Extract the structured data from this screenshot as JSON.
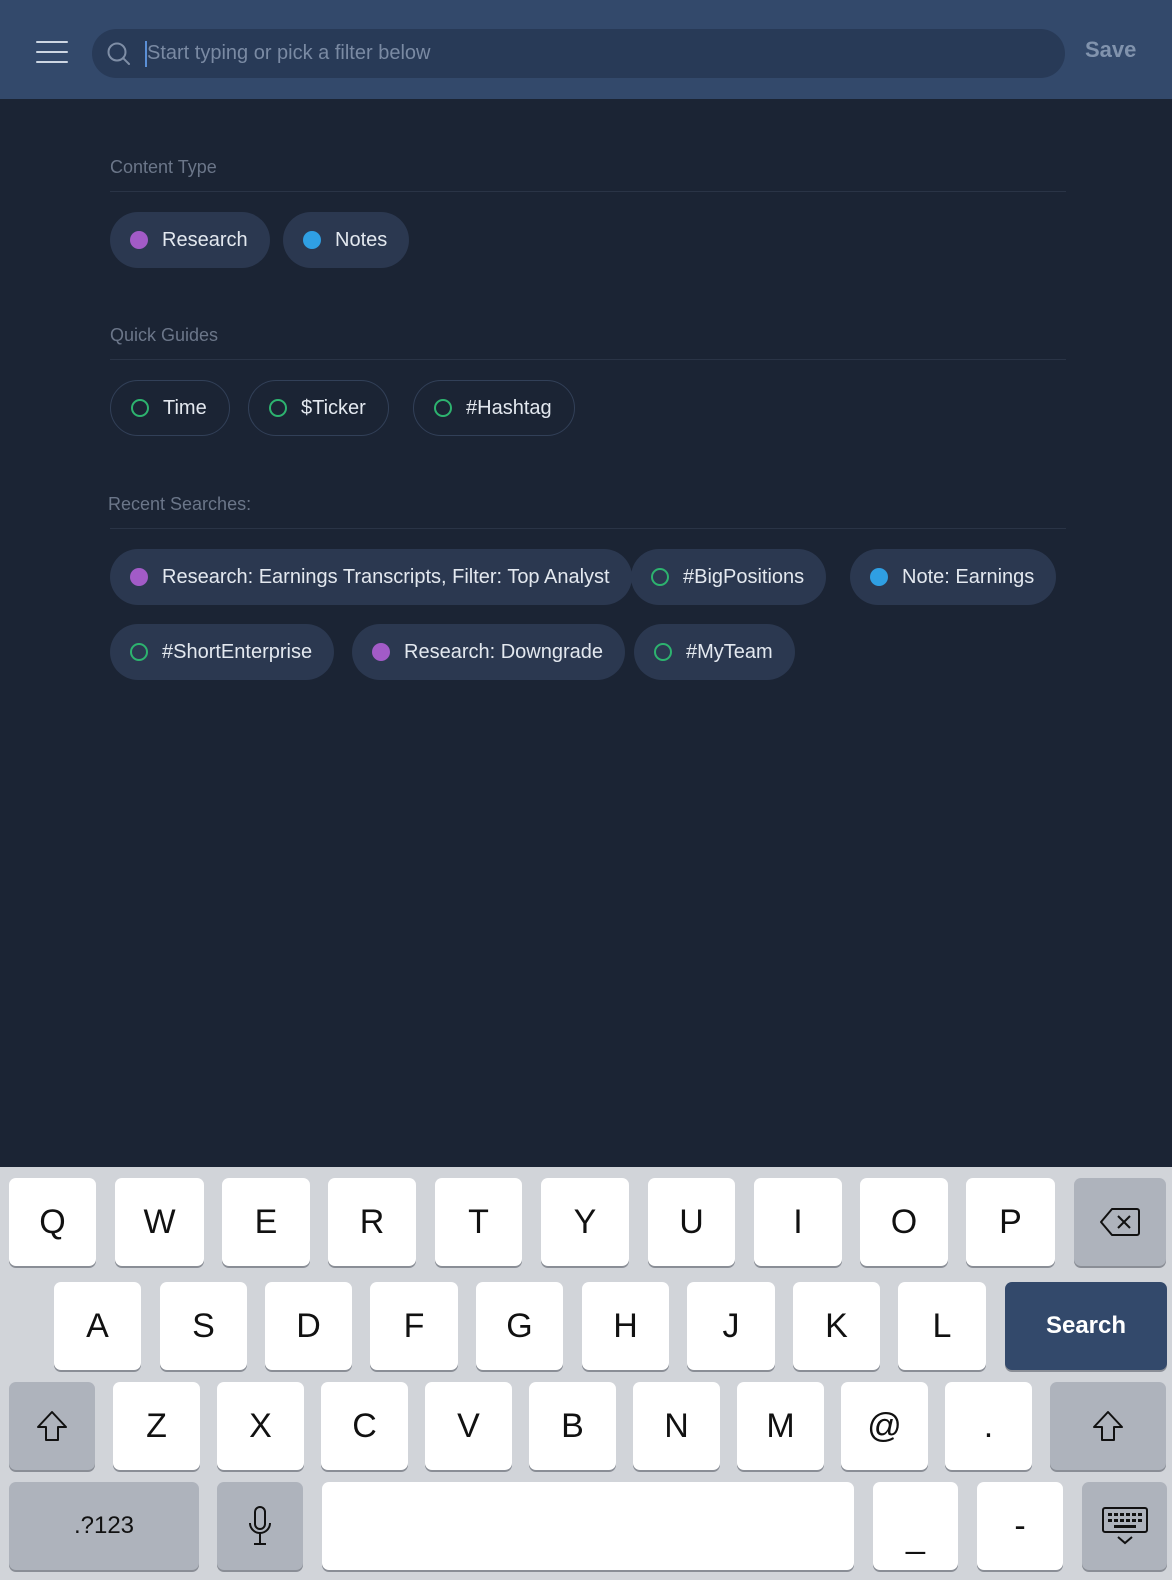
{
  "header": {
    "search_placeholder": "Start typing or pick a filter below",
    "save_label": "Save"
  },
  "content_type": {
    "title": "Content Type",
    "chips": [
      {
        "label": "Research",
        "dot": "purple"
      },
      {
        "label": "Notes",
        "dot": "blue"
      }
    ]
  },
  "quick_guides": {
    "title": "Quick Guides",
    "chips": [
      {
        "label": "Time",
        "dot": "ring"
      },
      {
        "label": "$Ticker",
        "dot": "ring"
      },
      {
        "label": "#Hashtag",
        "dot": "ring"
      }
    ]
  },
  "recent_searches": {
    "title": "Recent Searches:",
    "chips": [
      {
        "label": "Research: Earnings Transcripts, Filter: Top Analyst",
        "dot": "purple"
      },
      {
        "label": "#BigPositions",
        "dot": "ring"
      },
      {
        "label": "Note: Earnings",
        "dot": "blue"
      },
      {
        "label": "#ShortEnterprise",
        "dot": "ring"
      },
      {
        "label": "Research: Downgrade",
        "dot": "purple"
      },
      {
        "label": "#MyTeam",
        "dot": "ring"
      }
    ]
  },
  "keyboard": {
    "row1": [
      "Q",
      "W",
      "E",
      "R",
      "T",
      "Y",
      "U",
      "I",
      "O",
      "P"
    ],
    "row2": [
      "A",
      "S",
      "D",
      "F",
      "G",
      "H",
      "J",
      "K",
      "L"
    ],
    "row3": [
      "Z",
      "X",
      "C",
      "V",
      "B",
      "N",
      "M",
      "@",
      "."
    ],
    "search_label": "Search",
    "numbers_label": ".?123",
    "underscore_label": "_",
    "dash_label": "-"
  },
  "colors": {
    "header_bg": "#33496b",
    "page_bg": "#1b2434",
    "chip_bg": "#2b3850",
    "research_dot": "#a25bc7",
    "notes_dot": "#2f9fe3",
    "guide_ring": "#2db36f"
  },
  "icons": {
    "menu": "hamburger-menu-icon",
    "search": "search-icon",
    "backspace": "backspace-icon",
    "shift": "shift-icon",
    "microphone": "microphone-icon",
    "dismiss_keyboard": "keyboard-dismiss-icon"
  }
}
